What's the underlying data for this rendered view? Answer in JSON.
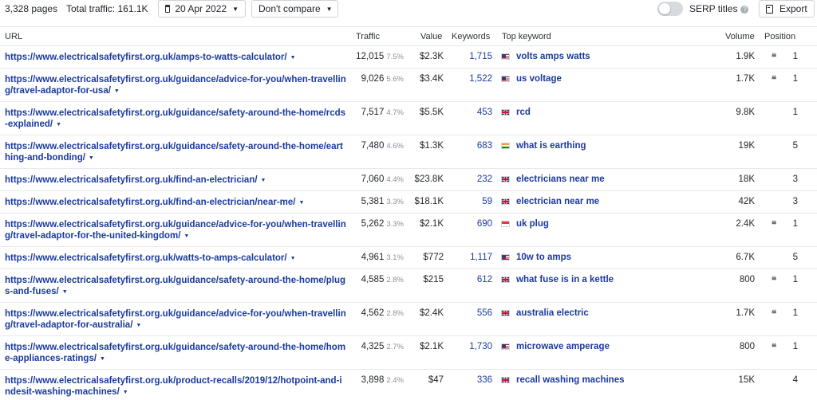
{
  "toolbar": {
    "pages": "3,328 pages",
    "total_traffic": "Total traffic: 161.1K",
    "date": "20 Apr 2022",
    "compare": "Don't compare",
    "serp_titles": "SERP titles",
    "export": "Export"
  },
  "headers": {
    "url": "URL",
    "traffic": "Traffic",
    "value": "Value",
    "keywords": "Keywords",
    "top_keyword": "Top keyword",
    "volume": "Volume",
    "position": "Position"
  },
  "rows": [
    {
      "url": "https://www.electricalsafetyfirst.org.uk/amps-to-watts-calculator/",
      "traffic": "12,015",
      "pct": "7.5%",
      "value": "$2.3K",
      "keywords": "1,715",
      "flag": "us",
      "top_keyword": "volts amps watts",
      "volume": "1.9K",
      "quote": "❝",
      "position": "1"
    },
    {
      "url": "https://www.electricalsafetyfirst.org.uk/guidance/advice-for-you/when-travelling/travel-adaptor-for-usa/",
      "traffic": "9,026",
      "pct": "5.6%",
      "value": "$3.4K",
      "keywords": "1,522",
      "flag": "us",
      "top_keyword": "us voltage",
      "volume": "1.7K",
      "quote": "❝",
      "position": "1"
    },
    {
      "url": "https://www.electricalsafetyfirst.org.uk/guidance/safety-around-the-home/rcds-explained/",
      "traffic": "7,517",
      "pct": "4.7%",
      "value": "$5.5K",
      "keywords": "453",
      "flag": "uk",
      "top_keyword": "rcd",
      "volume": "9.8K",
      "quote": "",
      "position": "1"
    },
    {
      "url": "https://www.electricalsafetyfirst.org.uk/guidance/safety-around-the-home/earthing-and-bonding/",
      "traffic": "7,480",
      "pct": "4.6%",
      "value": "$1.3K",
      "keywords": "683",
      "flag": "in",
      "top_keyword": "what is earthing",
      "volume": "19K",
      "quote": "",
      "position": "5"
    },
    {
      "url": "https://www.electricalsafetyfirst.org.uk/find-an-electrician/",
      "traffic": "7,060",
      "pct": "4.4%",
      "value": "$23.8K",
      "keywords": "232",
      "flag": "uk",
      "top_keyword": "electricians near me",
      "volume": "18K",
      "quote": "",
      "position": "3"
    },
    {
      "url": "https://www.electricalsafetyfirst.org.uk/find-an-electrician/near-me/",
      "traffic": "5,381",
      "pct": "3.3%",
      "value": "$18.1K",
      "keywords": "59",
      "flag": "uk",
      "top_keyword": "electrician near me",
      "volume": "42K",
      "quote": "",
      "position": "3"
    },
    {
      "url": "https://www.electricalsafetyfirst.org.uk/guidance/advice-for-you/when-travelling/travel-adaptor-for-the-united-kingdom/",
      "traffic": "5,262",
      "pct": "3.3%",
      "value": "$2.1K",
      "keywords": "690",
      "flag": "sg",
      "top_keyword": "uk plug",
      "volume": "2.4K",
      "quote": "❝",
      "position": "1"
    },
    {
      "url": "https://www.electricalsafetyfirst.org.uk/watts-to-amps-calculator/",
      "traffic": "4,961",
      "pct": "3.1%",
      "value": "$772",
      "keywords": "1,117",
      "flag": "us",
      "top_keyword": "10w to amps",
      "volume": "6.7K",
      "quote": "",
      "position": "5"
    },
    {
      "url": "https://www.electricalsafetyfirst.org.uk/guidance/safety-around-the-home/plugs-and-fuses/",
      "traffic": "4,585",
      "pct": "2.8%",
      "value": "$215",
      "keywords": "612",
      "flag": "uk",
      "top_keyword": "what fuse is in a kettle",
      "volume": "800",
      "quote": "❝",
      "position": "1"
    },
    {
      "url": "https://www.electricalsafetyfirst.org.uk/guidance/advice-for-you/when-travelling/travel-adaptor-for-australia/",
      "traffic": "4,562",
      "pct": "2.8%",
      "value": "$2.4K",
      "keywords": "556",
      "flag": "uk",
      "top_keyword": "australia electric",
      "volume": "1.7K",
      "quote": "❝",
      "position": "1"
    },
    {
      "url": "https://www.electricalsafetyfirst.org.uk/guidance/safety-around-the-home/home-appliances-ratings/",
      "traffic": "4,325",
      "pct": "2.7%",
      "value": "$2.1K",
      "keywords": "1,730",
      "flag": "us",
      "top_keyword": "microwave amperage",
      "volume": "800",
      "quote": "❝",
      "position": "1"
    },
    {
      "url": "https://www.electricalsafetyfirst.org.uk/product-recalls/2019/12/hotpoint-and-indesit-washing-machines/",
      "traffic": "3,898",
      "pct": "2.4%",
      "value": "$47",
      "keywords": "336",
      "flag": "uk",
      "top_keyword": "recall washing machines",
      "volume": "15K",
      "quote": "",
      "position": "4"
    }
  ]
}
